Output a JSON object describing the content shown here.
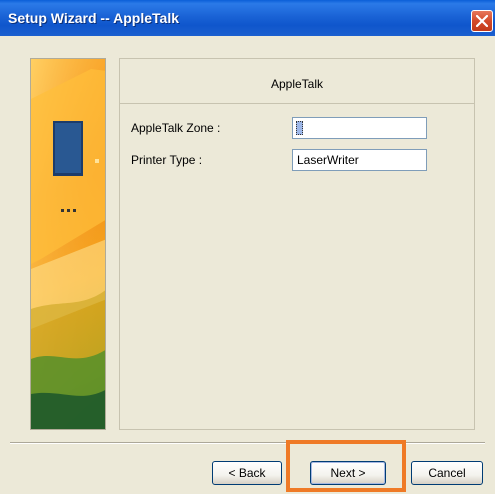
{
  "window": {
    "title": "Setup Wizard -- AppleTalk"
  },
  "panel": {
    "heading": "AppleTalk",
    "fields": [
      {
        "label": "AppleTalk Zone :",
        "value": ""
      },
      {
        "label": "Printer Type :",
        "value": "LaserWriter"
      }
    ]
  },
  "buttons": {
    "back": "< Back",
    "next": "Next >",
    "cancel": "Cancel"
  },
  "colors": {
    "titlebar": "#0f56cc",
    "highlight": "#ef7a26",
    "close_button": "#d34a2a"
  },
  "icons": {
    "close": "close-icon",
    "side_art": "printer-illustration"
  }
}
